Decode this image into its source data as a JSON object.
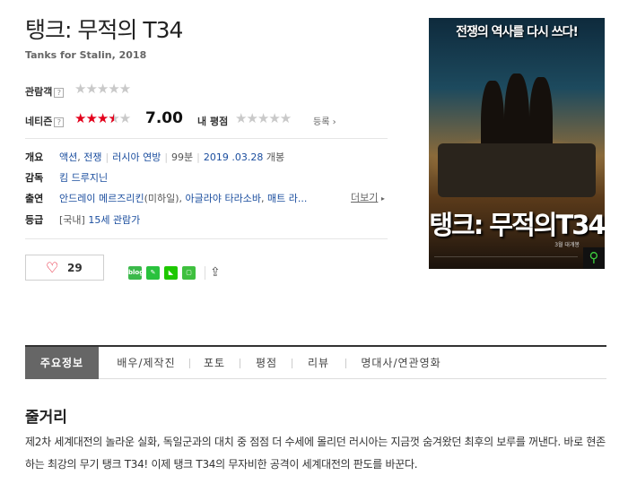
{
  "movie": {
    "title": "탱크: 무적의 T34",
    "subtitle": "Tanks for Stalin, 2018"
  },
  "ratings": {
    "audience_label": "관람객",
    "audience_stars": 0,
    "netizen_label": "네티즌",
    "netizen_score": "7.00",
    "netizen_stars": 3.5,
    "my_rating_label": "내 평점",
    "register_label": "등록",
    "help_mark": "?",
    "star_color": "#e3001b"
  },
  "info": {
    "overview_label": "개요",
    "genres": [
      "액션",
      "전쟁"
    ],
    "country": "러시아 연방",
    "runtime": "99분",
    "release": "2019 .03.28",
    "release_suffix": "개봉",
    "director_label": "감독",
    "director": "킴 드루지닌",
    "cast_label": "출연",
    "cast_1": "안드레이 메르즈리킨",
    "cast_1_role": "(미하일)",
    "cast_2": "아글라야 타라소바",
    "cast_3": "매트 라...",
    "more_label": "더보기",
    "grade_label": "등급",
    "grade_prefix": "[국내]",
    "grade": "15세 관람가"
  },
  "actions": {
    "like_count": "29",
    "share_icons": [
      "blog-icon",
      "band-icon",
      "naver-icon",
      "cafe-icon"
    ],
    "blog_text": "blog"
  },
  "poster": {
    "tagline": "전쟁의 역사를 다시 쓰다!",
    "title": "탱크: 무적의T34",
    "date_text": "3월 대개봉"
  },
  "tabs": [
    "주요정보",
    "배우/제작진",
    "포토",
    "평점",
    "리뷰",
    "명대사/연관영화"
  ],
  "synopsis": {
    "heading": "줄거리",
    "body": "제2차 세계대전의 놀라운 실화, 독일군과의 대치 중 점점 더 수세에 몰리던 러시아는 지금껏 숨겨왔던 최후의 보루를 꺼낸다. 바로 현존하는 최강의 무기 탱크 T34! 이제 탱크 T34의 무자비한 공격이 세계대전의 판도를 바꾼다."
  }
}
